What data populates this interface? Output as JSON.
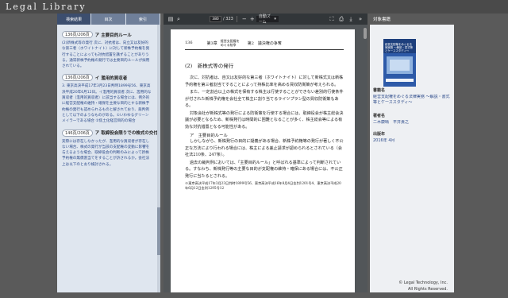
{
  "header": {
    "logo": "Legal Library"
  },
  "left_panel": {
    "tabs": [
      {
        "label": "検索結果",
        "active": true
      },
      {
        "label": "目次",
        "active": false
      },
      {
        "label": "索引",
        "active": false
      }
    ],
    "sections": [
      {
        "range": "136頁/206頁",
        "title": "ア 主要目的ルール",
        "text": "(2)新株式等の発行 次に、対抗者は、向立又は友好的な第三者（ホワイトナイト）に対して新株予約権を発行することによっても対抗措置を講ずることがありうる。通常新株予約権の発行では主要目的ルールが採用されている。"
      },
      {
        "range": "136頁/206頁",
        "title": "イ 濫用的買収者",
        "text": "3. 東京高決平成17年3月23日判時1899号56、東京高決平成20年6月12日。イ濫用的買収者 次に、濫用的な買収者（濫用的買収者）に該当する場合には、例外的に経営支配権の維持・確保を主要な目的とする新株予約権の発行も認められるものと解されており、裁判例として以下のようなものがある。①いわゆるグリーンメイラーである場合 ②焦土化経営目的の場合"
      },
      {
        "range": "146頁/206頁",
        "title": "ア 取締役会限りでの株式の交付",
        "text": "実際には存在しなかったが、濫用的な買収者が存在しない場合、株式の発行が当該の支配権の変動に影響を与えるような場合、取締役会の判断のみによって新株予約権の無償割当てをすることが許されるか。会社法上は以下のとおり検討される。"
      }
    ]
  },
  "viewer": {
    "page_current": "380",
    "page_total": "/ 323",
    "zoom": "自動ズーム",
    "running_head": {
      "page_number": "136",
      "chapter": "第3章",
      "chapter_title_1": "経営支配権を",
      "chapter_title_2": "めぐる紛争",
      "section": "第2　議決権の争奪"
    },
    "heading": "(2)　新株式等の発行",
    "paragraphs": [
      "次に、対抗者は、自又は友好的な第三者（ホワイトナイト）に対して新株式又は新株予約権を第三者割当てすることによって持株比率を高める買収防衛策が考えられる。",
      "また、一定割合以上の株式を保有する株主は行使することができない差別的行使条件が付された新株予約権を会社全て株主に割り当てるライツプラン型の買収防衛策もある。",
      "対象会社が新株式等の発行による防衛策を行使する場合には、取締役会が株主総会決議が必要となるため、新株発行は時間的に困難となることが多く、株主総会等による有効な対抗措置となる可能性がある。"
    ],
    "subheading": "ア　主要目的ルール",
    "paragraphs2": [
      "しかしながら、新株発行の目的に疑義がある場合、新株予約権等の発行が著しく不公正な方法により行われる場合には、株主による差止請求が認められるとされている（会社法210条、247条）。",
      "過去の裁判例においては、「主要目的ルール」と呼ばれる基準によって判断されている。すなわち、新株発行等の主要な目的が支配権の維持・確保にある場合には、不公正発行に当たるとされる。"
    ],
    "footnote": "※東京高決平成17年3月23日判時1899号56、東京高決平成16年8月4日金判1201号4、東京高決平成20年6月12日金判1295号12"
  },
  "right_panel": {
    "header": "対象書籍",
    "cover_title": "経営支配権をめぐる法律実務 ～解説・書式等とケーススタディ～",
    "book_title_label": "書籍名",
    "book_title": "経営支配権をめぐる法律実務 ～解説・書式等とケーススタディ～",
    "author_label": "著者名",
    "author": "二木康晴　平井貴之",
    "published_label": "出版年",
    "published": "2016年 4月",
    "copyright_1": "© Legal Technology, Inc.",
    "copyright_2": "All Rights Reserved."
  },
  "colors": {
    "header_bg": "#4a4a4a",
    "tab_active": "#3c4e6e",
    "link_blue": "#2c4a8a",
    "viewer_bg": "#525659"
  },
  "icons": [
    "sidebar-toggle-icon",
    "search-icon",
    "prev-page-icon",
    "next-page-icon",
    "zoom-out-icon",
    "zoom-in-icon",
    "fullscreen-icon",
    "print-icon",
    "download-icon",
    "menu-icon"
  ]
}
